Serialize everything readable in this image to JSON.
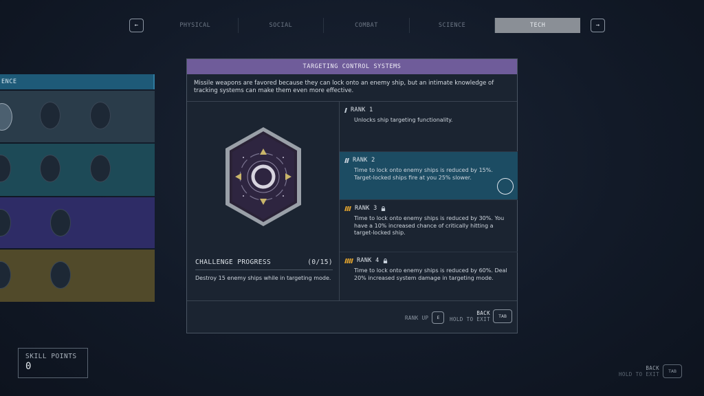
{
  "nav": {
    "prev_icon": "arrow-left-icon",
    "next_icon": "arrow-right-icon",
    "prev_glyph": "←",
    "next_glyph": "→",
    "tabs": [
      {
        "label": "PHYSICAL",
        "active": false
      },
      {
        "label": "SOCIAL",
        "active": false
      },
      {
        "label": "COMBAT",
        "active": false
      },
      {
        "label": "SCIENCE",
        "active": false
      },
      {
        "label": "TECH",
        "active": true
      }
    ]
  },
  "skill_tree": {
    "header_label": "ENCE",
    "rows": [
      {
        "color": "#2a3c4a"
      },
      {
        "color": "#1d4a57"
      },
      {
        "color": "#2e2c66"
      },
      {
        "color": "#514a2a"
      }
    ]
  },
  "skill_points": {
    "label": "SKILL POINTS",
    "value": "0"
  },
  "panel": {
    "title": "TARGETING CONTROL SYSTEMS",
    "description": "Missile weapons are favored because they can lock onto an enemy ship, but an intimate knowledge of tracking systems can make them even more effective.",
    "challenge": {
      "label": "CHALLENGE PROGRESS",
      "progress": "(0/15)",
      "description": "Destroy 15 enemy ships while in targeting mode."
    },
    "ranks": [
      {
        "label": "RANK 1",
        "locked": false,
        "text": "Unlocks ship targeting functionality."
      },
      {
        "label": "RANK 2",
        "locked": false,
        "text": "Time to lock onto enemy ships is reduced by 15%. Target-locked ships fire at you 25% slower."
      },
      {
        "label": "RANK 3",
        "locked": true,
        "text": "Time to lock onto enemy ships is reduced by 30%. You have a 10% increased chance of critically hitting a target-locked ship."
      },
      {
        "label": "RANK 4",
        "locked": true,
        "text": "Time to lock onto enemy ships is reduced by 60%. Deal 20% increased system damage in targeting mode."
      }
    ],
    "footer": {
      "rank_up_label": "RANK UP",
      "rank_up_key": "E",
      "back_label": "BACK",
      "hold_label": "HOLD TO EXIT",
      "back_key": "TAB"
    }
  },
  "global_back": {
    "back_label": "BACK",
    "hold_label": "HOLD TO EXIT",
    "key": "TAB"
  },
  "colors": {
    "accent_purple": "#6f5c9a",
    "selected_rank": "#1c4c63",
    "tab_active": "#8a8f96",
    "rank_bar_owned": "#c9d2dc",
    "rank_bar_locked": "#e0a22e"
  }
}
